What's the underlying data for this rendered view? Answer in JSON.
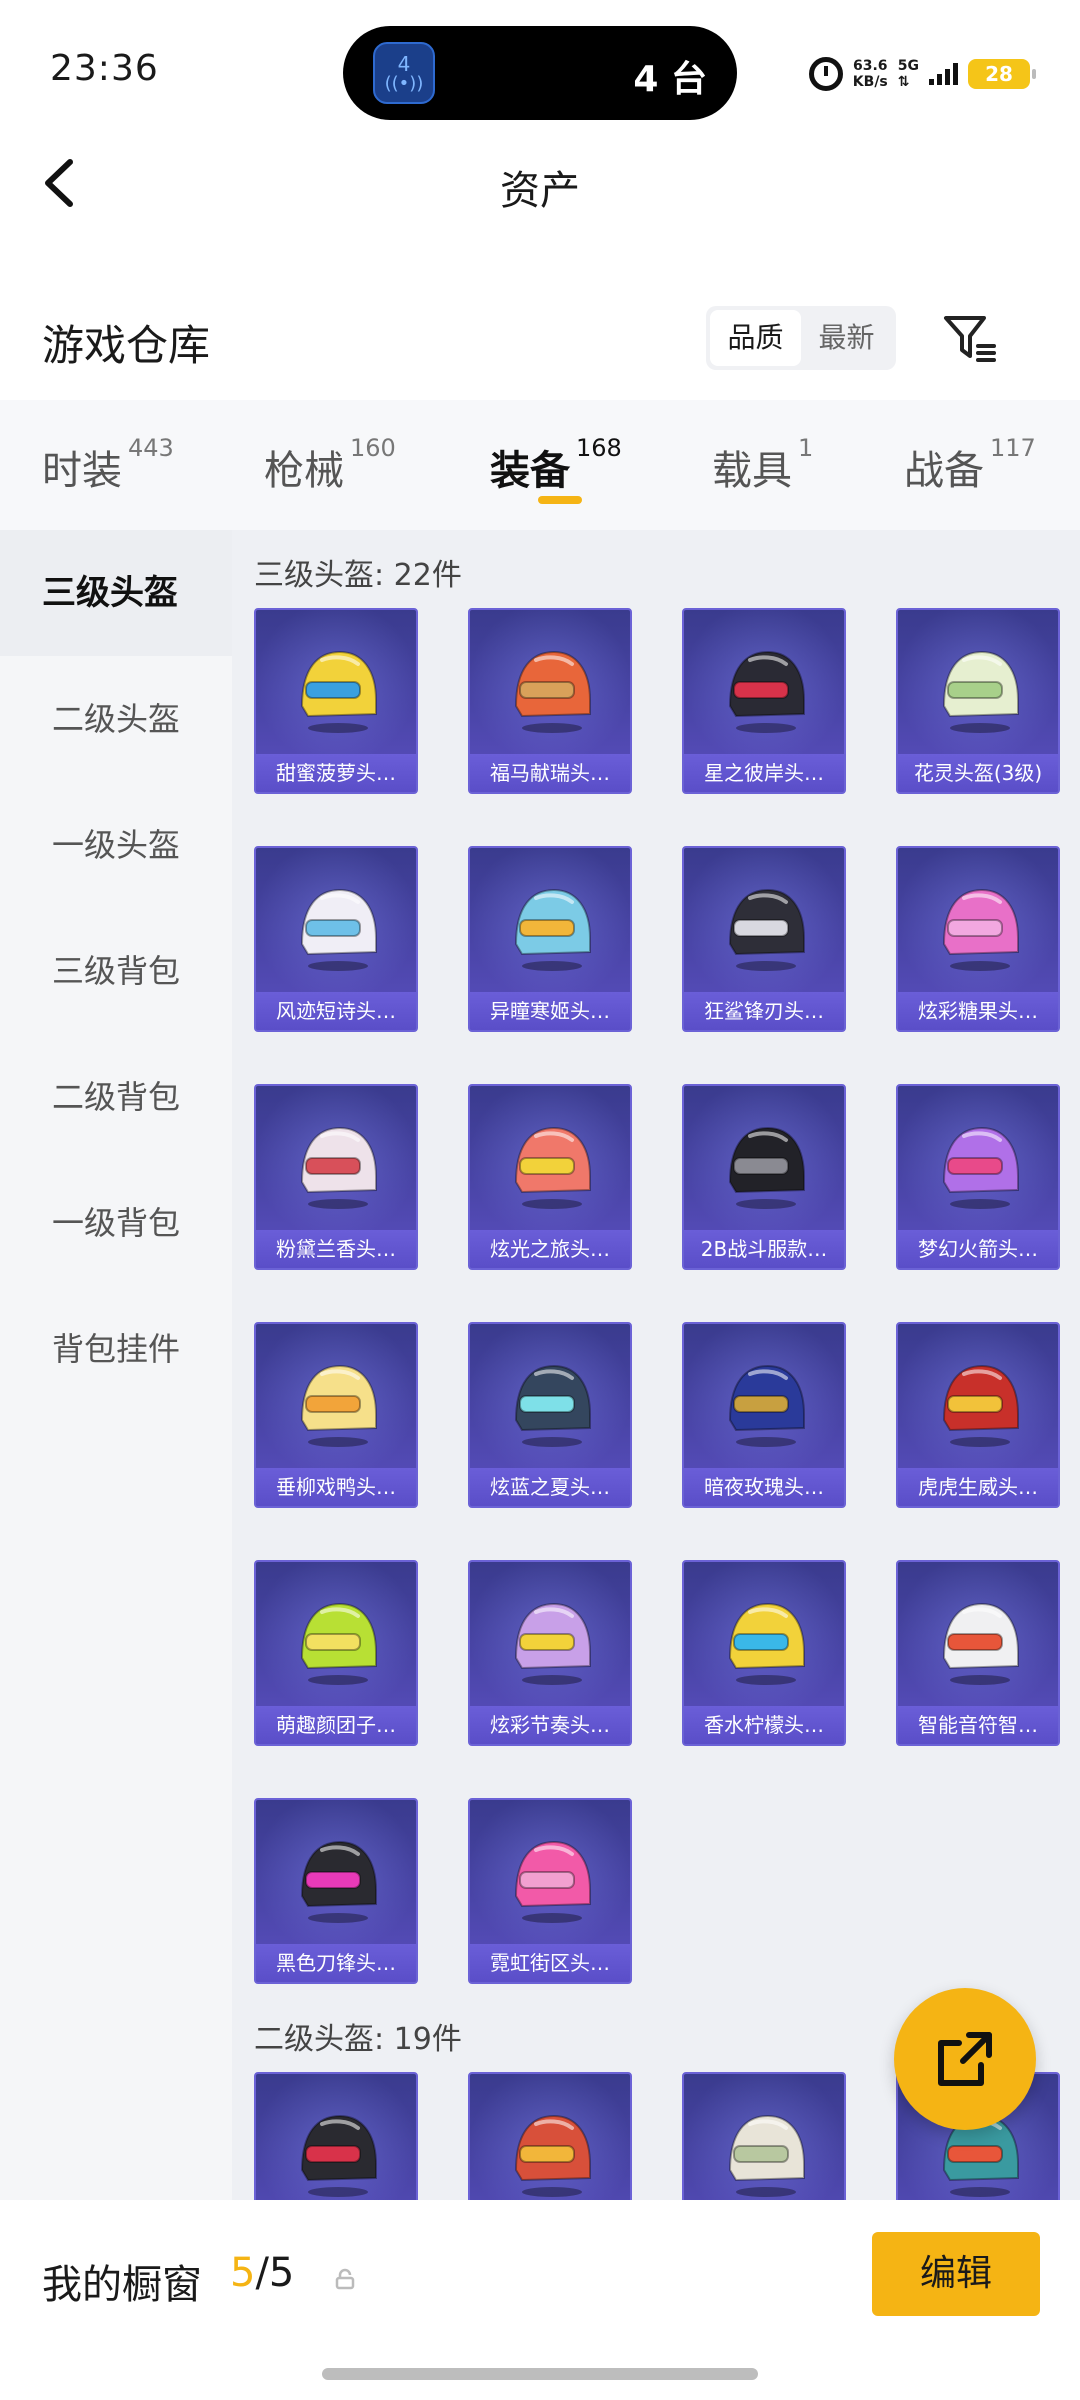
{
  "status_bar": {
    "time": "23:36",
    "island_badge": "4",
    "island_text": "4 台",
    "net_speed_value": "63.6",
    "net_speed_unit": "KB/s",
    "network": "5G",
    "battery": "28"
  },
  "header": {
    "title": "资产"
  },
  "section": {
    "title": "游戏仓库",
    "sort_options": [
      "品质",
      "最新"
    ]
  },
  "tabs": [
    {
      "label": "时装",
      "count": "443"
    },
    {
      "label": "枪械",
      "count": "160"
    },
    {
      "label": "装备",
      "count": "168"
    },
    {
      "label": "载具",
      "count": "1"
    },
    {
      "label": "战备",
      "count": "117"
    }
  ],
  "side_menu": [
    "三级头盔",
    "二级头盔",
    "一级头盔",
    "三级背包",
    "二级背包",
    "一级背包",
    "背包挂件"
  ],
  "groups": [
    {
      "label": "三级头盔: 22件",
      "items": [
        {
          "name": "甜蜜菠萝头…",
          "color": "#f2d23a",
          "accent": "#3aa0e0"
        },
        {
          "name": "福马献瑞头…",
          "color": "#e8663a",
          "accent": "#d9a15a"
        },
        {
          "name": "星之彼岸头…",
          "color": "#2a2a34",
          "accent": "#d8324a"
        },
        {
          "name": "花灵头盔(3级)",
          "color": "#e6efd0",
          "accent": "#a8d08a"
        },
        {
          "name": "风迹短诗头…",
          "color": "#f0eef6",
          "accent": "#6ec0e8"
        },
        {
          "name": "异瞳寒姬头…",
          "color": "#7ccbe6",
          "accent": "#f2b63a"
        },
        {
          "name": "狂鲨锋刃头…",
          "color": "#2e2e38",
          "accent": "#d8d8e0"
        },
        {
          "name": "炫彩糖果头…",
          "color": "#e870c8",
          "accent": "#f2a8e0"
        },
        {
          "name": "粉黛兰香头…",
          "color": "#eee2ea",
          "accent": "#d8505a"
        },
        {
          "name": "炫光之旅头…",
          "color": "#f0786a",
          "accent": "#f2d23a"
        },
        {
          "name": "2B战斗服款…",
          "color": "#222228",
          "accent": "#8a8a92"
        },
        {
          "name": "梦幻火箭头…",
          "color": "#b070e8",
          "accent": "#e84a8a"
        },
        {
          "name": "垂柳戏鸭头…",
          "color": "#f6e08a",
          "accent": "#f2a43a"
        },
        {
          "name": "炫蓝之夏头…",
          "color": "#34465e",
          "accent": "#7ee0e8"
        },
        {
          "name": "暗夜玫瑰头…",
          "color": "#2a3a9a",
          "accent": "#c8a040"
        },
        {
          "name": "虎虎生威头…",
          "color": "#c8302a",
          "accent": "#f2c23a"
        },
        {
          "name": "萌趣颜团子…",
          "color": "#b8e034",
          "accent": "#f2e060"
        },
        {
          "name": "炫彩节奏头…",
          "color": "#c8a0e8",
          "accent": "#f2d23a"
        },
        {
          "name": "香水柠檬头…",
          "color": "#f2d23a",
          "accent": "#3ab8e8"
        },
        {
          "name": "智能音符智…",
          "color": "#f0f0f2",
          "accent": "#e8563a"
        },
        {
          "name": "黑色刀锋头…",
          "color": "#2a2a30",
          "accent": "#e83ab8"
        },
        {
          "name": "霓虹街区头…",
          "color": "#f25aa8",
          "accent": "#f2a0d0"
        }
      ]
    },
    {
      "label": "二级头盔: 19件",
      "items": [
        {
          "name": "",
          "color": "#2a2a30",
          "accent": "#d8324a"
        },
        {
          "name": "",
          "color": "#d8503a",
          "accent": "#f2b63a"
        },
        {
          "name": "",
          "color": "#e8e4d8",
          "accent": "#b8c8a0"
        },
        {
          "name": "",
          "color": "#3a9aa0",
          "accent": "#e8563a"
        }
      ]
    }
  ],
  "bottom_bar": {
    "label": "我的橱窗",
    "current": "5",
    "total": "/5",
    "edit_label": "编辑"
  }
}
